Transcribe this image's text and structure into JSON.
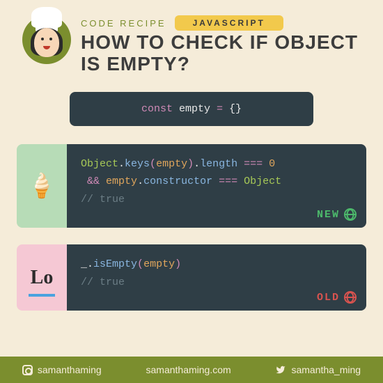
{
  "header": {
    "eyebrow": "CODE RECIPE",
    "language": "JAVASCRIPT",
    "title": "HOW TO CHECK IF OBJECT IS EMPTY?"
  },
  "declare": {
    "kw": "const",
    "name": "empty",
    "eq": "=",
    "val": "{}"
  },
  "newPanel": {
    "icon": "🍦",
    "line1": {
      "cls": "Object",
      "dot1": ".",
      "keys": "keys",
      "lp": "(",
      "arg": "empty",
      "rp": ")",
      "dot2": ".",
      "len": "length",
      "eq": "===",
      "zero": "0"
    },
    "line2": {
      "and": "&&",
      "arg": "empty",
      "dot": ".",
      "ctor": "constructor",
      "eq": "===",
      "obj": "Object"
    },
    "comment": "// true",
    "badge": "NEW"
  },
  "oldPanel": {
    "icon": "Lo",
    "underscore": "_",
    "dot": ".",
    "fn": "isEmpty",
    "lp": "(",
    "arg": "empty",
    "rp": ")",
    "comment": "// true",
    "badge": "OLD"
  },
  "footer": {
    "instagram": "samanthaming",
    "site": "samanthaming.com",
    "twitter": "samantha_ming"
  }
}
